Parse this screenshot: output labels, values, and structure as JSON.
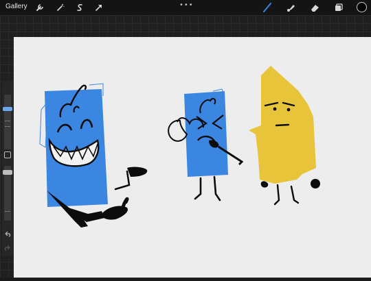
{
  "toolbar": {
    "gallery_label": "Gallery",
    "left_icons": [
      "wrench-icon",
      "magic-wand-icon",
      "selection-s-icon",
      "transform-arrow-icon"
    ],
    "more_label": "•••",
    "right_icons": [
      "brush-icon",
      "smudge-icon",
      "eraser-icon",
      "layers-icon"
    ],
    "active_tool": "brush",
    "current_color": "#000000",
    "accent_color": "#3a86e0"
  },
  "sidebar": {
    "brush_size_level": 0.3,
    "opacity_level": 0.55,
    "modify_button": "square-icon",
    "undo": "undo-icon",
    "redo": "redo-icon"
  },
  "canvas": {
    "background": "#ededed",
    "colors": {
      "blue": "#3a86e0",
      "yellow": "#e7c43a",
      "ink": "#0c0c0c"
    }
  }
}
